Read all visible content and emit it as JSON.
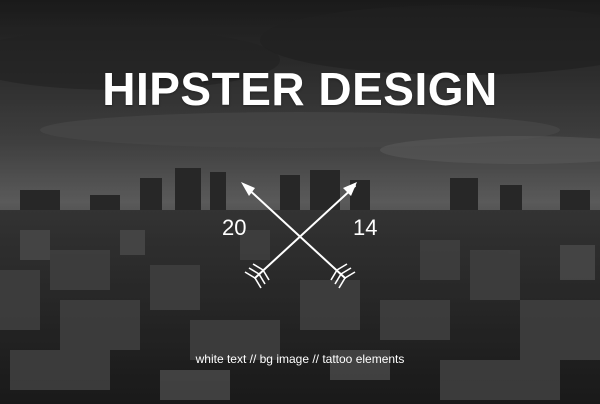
{
  "hero": {
    "title": "HIPSTER DESIGN",
    "year_left": "20",
    "year_right": "14",
    "tagline": "white text // bg image // tattoo elements"
  },
  "emblem": {
    "icon": "crossed-arrows-icon"
  },
  "background": {
    "description_icon": "city-skyline-background",
    "sky_color": "#3f3f3f",
    "city_color": "#262626"
  },
  "colors": {
    "text": "#ffffff"
  }
}
